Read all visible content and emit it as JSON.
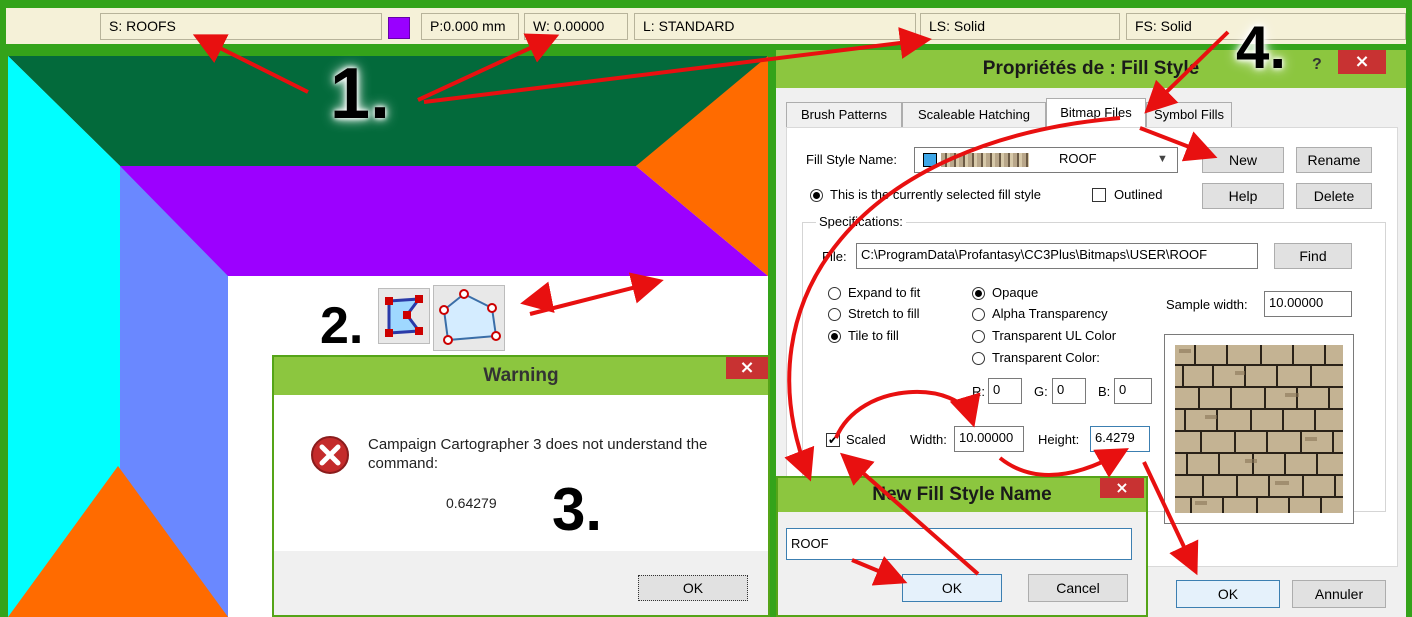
{
  "status_bar": {
    "sheet": "S: ROOFS",
    "color": "#9900ff",
    "pen": "P:0.000 mm",
    "width": "W: 0.00000",
    "layer": "L: STANDARD",
    "line_style": "LS: Solid",
    "fill_style": "FS: Solid"
  },
  "map": {
    "colors": {
      "dark_green": "#036a3b",
      "purple": "#9c00ff",
      "cyan": "#00ffff",
      "periwinkle": "#6a88ff",
      "orange": "#ff6b00"
    }
  },
  "toolbar_icons": [
    "edit-nodes-icon",
    "polygon-icon"
  ],
  "warning_dialog": {
    "title": "Warning",
    "close": "×",
    "message": "Campaign Cartographer 3 does not understand the command:",
    "value": "0.64279",
    "ok": "OK"
  },
  "properties_dialog": {
    "title": "Propriétés de : Fill Style",
    "help_glyph": "?",
    "close": "×",
    "tabs": [
      "Brush Patterns",
      "Scaleable Hatching",
      "Bitmap Files",
      "Symbol Fills"
    ],
    "active_tab": "Bitmap Files",
    "fill_style_name_label": "Fill Style Name:",
    "fill_style_name_value": "ROOF",
    "buttons": {
      "new": "New",
      "rename": "Rename",
      "help": "Help",
      "delete": "Delete",
      "find": "Find",
      "ok": "OK",
      "cancel": "Annuler"
    },
    "current_style_label": "This is the currently selected fill style",
    "outlined_label": "Outlined",
    "specifications_label": "Specifications:",
    "file_label": "File:",
    "file_value": "C:\\ProgramData\\Profantasy\\CC3Plus\\Bitmaps\\USER\\ROOF",
    "fit_options": [
      "Expand to fit",
      "Stretch to fill",
      "Tile to fill"
    ],
    "fit_selected": "Tile to fill",
    "transparency_options": [
      "Opaque",
      "Alpha Transparency",
      "Transparent UL Color",
      "Transparent Color:"
    ],
    "transparency_selected": "Opaque",
    "sample_width_label": "Sample width:",
    "sample_width_value": "10.00000",
    "r_label": "R:",
    "r_value": "0",
    "g_label": "G:",
    "g_value": "0",
    "b_label": "B:",
    "b_value": "0",
    "scaled_label": "Scaled",
    "scaled_checked": true,
    "width_label": "Width:",
    "width_value": "10.00000",
    "height_label": "Height:",
    "height_value": "6.4279"
  },
  "new_fill_dialog": {
    "title": "New Fill Style Name",
    "close": "×",
    "name_value": "ROOF",
    "ok": "OK",
    "cancel": "Cancel"
  },
  "annotations": {
    "step1": "1.",
    "step2": "2.",
    "step3": "3.",
    "step4": "4.",
    "arrow_color": "#e81010"
  }
}
